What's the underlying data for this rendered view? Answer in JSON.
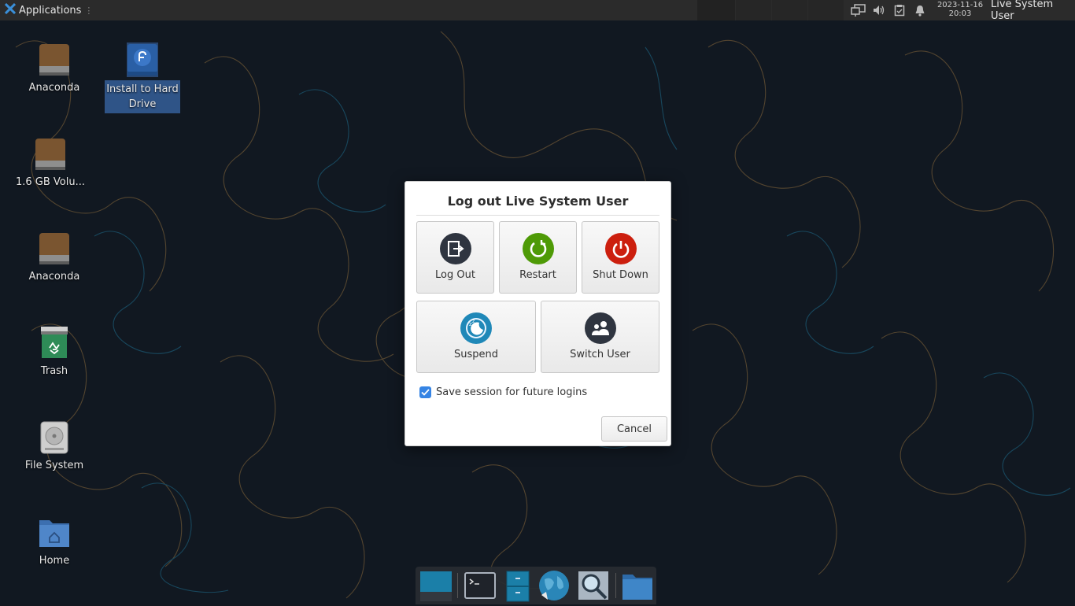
{
  "panel": {
    "applications_label": "Applications",
    "clock_date": "2023-11-16",
    "clock_time": "20:03",
    "user_label": "Live System User"
  },
  "desktop": {
    "icons": [
      {
        "label": "Anaconda"
      },
      {
        "label": "Install to Hard Drive"
      },
      {
        "label": "1.6 GB Volu..."
      },
      {
        "label": "Anaconda"
      },
      {
        "label": "Trash"
      },
      {
        "label": "File System"
      },
      {
        "label": "Home"
      }
    ]
  },
  "dialog": {
    "title": "Log out Live System User",
    "buttons": {
      "logout": "Log Out",
      "restart": "Restart",
      "shutdown": "Shut Down",
      "suspend": "Suspend",
      "switch_user": "Switch User"
    },
    "save_session_label": "Save session for future logins",
    "save_session_checked": true,
    "cancel_label": "Cancel"
  },
  "colors": {
    "logout": "#2f3540",
    "restart": "#4e9a06",
    "shutdown": "#cc1f0e",
    "suspend": "#1f88b8",
    "switch_user": "#2f3540",
    "checkbox": "#3584e4"
  }
}
